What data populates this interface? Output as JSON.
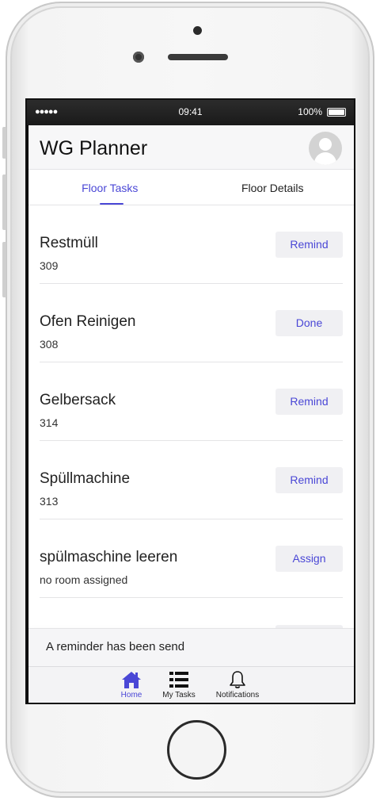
{
  "status_bar": {
    "signal": "●●●●● ",
    "time": "09:41",
    "battery": "100%"
  },
  "header": {
    "title": "WG Planner"
  },
  "tabs": [
    {
      "label": "Floor Tasks",
      "active": true
    },
    {
      "label": "Floor Details",
      "active": false
    }
  ],
  "tasks": [
    {
      "name": "Restmüll",
      "room": "309",
      "action": "Remind"
    },
    {
      "name": "Ofen Reinigen",
      "room": "308",
      "action": "Done"
    },
    {
      "name": "Gelbersack",
      "room": "314",
      "action": "Remind"
    },
    {
      "name": "Spüllmachine",
      "room": "313",
      "action": "Remind"
    },
    {
      "name": "spülmaschine leeren",
      "room": "no room assigned",
      "action": "Assign"
    }
  ],
  "toast": {
    "message": "A reminder has been send"
  },
  "tabbar": [
    {
      "label": "Home",
      "icon": "home-icon",
      "active": true
    },
    {
      "label": "My Tasks",
      "icon": "list-icon",
      "active": false
    },
    {
      "label": "Notifications",
      "icon": "bell-icon",
      "active": false
    }
  ],
  "colors": {
    "accent": "#4a47d6",
    "button_bg": "#f0f0f3",
    "header_bg": "#f7f7f8"
  }
}
